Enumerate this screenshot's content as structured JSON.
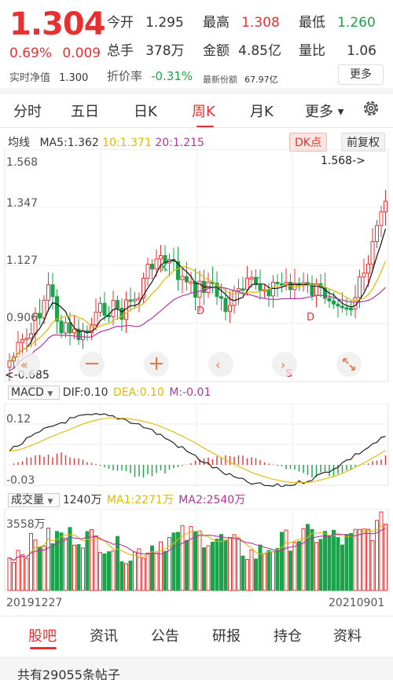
{
  "quote": {
    "price": "1.304",
    "change_pct": "0.69%",
    "change_amt": "0.009",
    "stats": [
      {
        "label": "今开",
        "value": "1.295",
        "color": "#333"
      },
      {
        "label": "最高",
        "value": "1.308",
        "color": "#e93030"
      },
      {
        "label": "最低",
        "value": "1.260",
        "color": "#1aa34a"
      },
      {
        "label": "总手",
        "value": "378万",
        "color": "#333"
      },
      {
        "label": "金额",
        "value": "4.85亿",
        "color": "#333"
      },
      {
        "label": "量比",
        "value": "1.06",
        "color": "#333"
      }
    ],
    "nav_label": "实时净值",
    "nav_value": "1.300",
    "discount_label": "折价率",
    "discount_value": "-0.31%",
    "shares_label": "最新份额",
    "shares_value": "67.97亿",
    "more_label": "更多"
  },
  "tabs": [
    {
      "label": "分时",
      "active": false
    },
    {
      "label": "五日",
      "active": false
    },
    {
      "label": "日K",
      "active": false
    },
    {
      "label": "周K",
      "active": true
    },
    {
      "label": "月K",
      "active": false
    },
    {
      "label": "更多",
      "active": false
    }
  ],
  "kline": {
    "legend_title": "均线",
    "ma5": "MA5:1.362",
    "ma10": "10:1.371",
    "ma20": "20:1.215",
    "dk_label": "DK点",
    "adjust_label": "前复权",
    "y_labels": [
      "1.568",
      "1.347",
      "1.127",
      "0.906"
    ],
    "max_marker": "1.568->",
    "min_marker": "<-0.685",
    "signals": [
      "K",
      "D",
      "K",
      "D",
      "S"
    ]
  },
  "macd": {
    "title": "MACD",
    "dif": "DIF:0.10",
    "dea": "DEA:0.10",
    "m": "M:-0.01",
    "y_top": "0.12",
    "y_bottom": "-0.03"
  },
  "volume": {
    "title": "成交量",
    "current": "1240万",
    "ma1": "MA1:2271万",
    "ma2": "MA2:2540万",
    "y_top": "3558万",
    "start_date": "20191227",
    "end_date": "20210901"
  },
  "bottom_tabs": [
    {
      "label": "股吧",
      "active": true
    },
    {
      "label": "资讯",
      "active": false
    },
    {
      "label": "公告",
      "active": false
    },
    {
      "label": "研报",
      "active": false
    },
    {
      "label": "持仓",
      "active": false
    },
    {
      "label": "资料",
      "active": false
    }
  ],
  "posts_count": "共有29055条帖子",
  "colors": {
    "up": "#e93030",
    "down": "#1aa34a",
    "ma5": "#111111",
    "ma10": "#e0b800",
    "ma20": "#b0359e"
  }
}
